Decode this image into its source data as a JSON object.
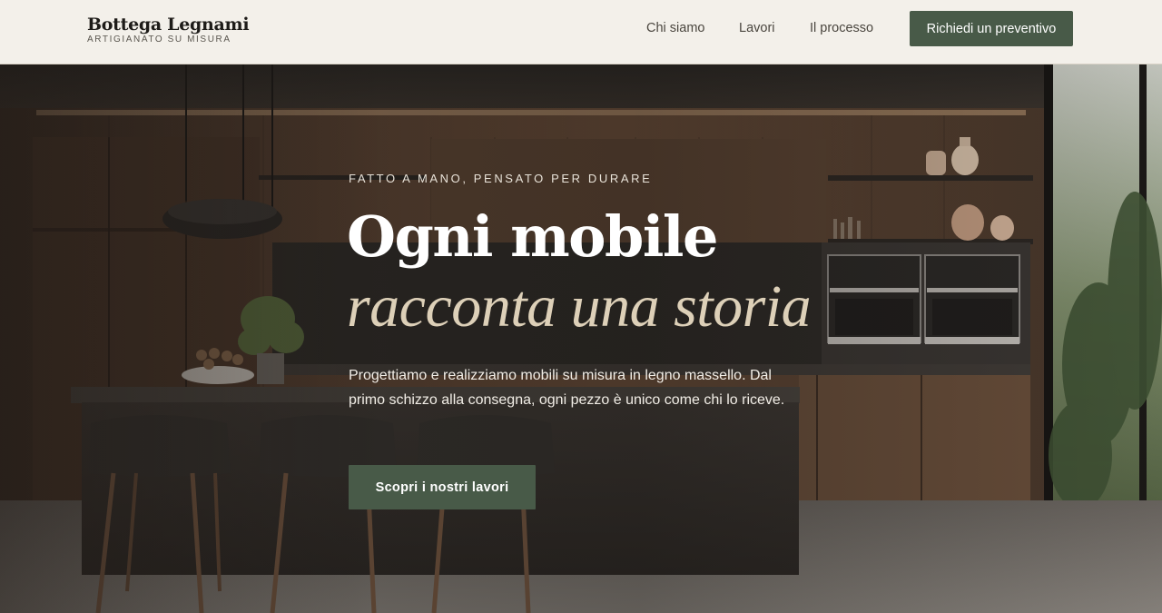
{
  "brand": {
    "name": "Bottega Legnami",
    "tagline": "ARTIGIANATO SU MISURA"
  },
  "nav": {
    "items": [
      {
        "label": "Chi siamo"
      },
      {
        "label": "Lavori"
      },
      {
        "label": "Il processo"
      }
    ],
    "cta_label": "Richiedi un preventivo"
  },
  "hero": {
    "eyebrow": "FATTO A MANO, PENSATO PER DURARE",
    "title_line1": "Ogni mobile",
    "title_line2": "racconta una storia",
    "lead": "Progettiamo e realizziamo mobili su misura in legno massello. Dal primo schizzo alla consegna, ogni pezzo è unico come chi lo riceve.",
    "cta_label": "Scopri i nostri lavori"
  },
  "colors": {
    "header_bg": "#f3f0ea",
    "accent_green": "#485a48",
    "title_white": "#ffffff",
    "title_italic": "#ddd0b8"
  }
}
